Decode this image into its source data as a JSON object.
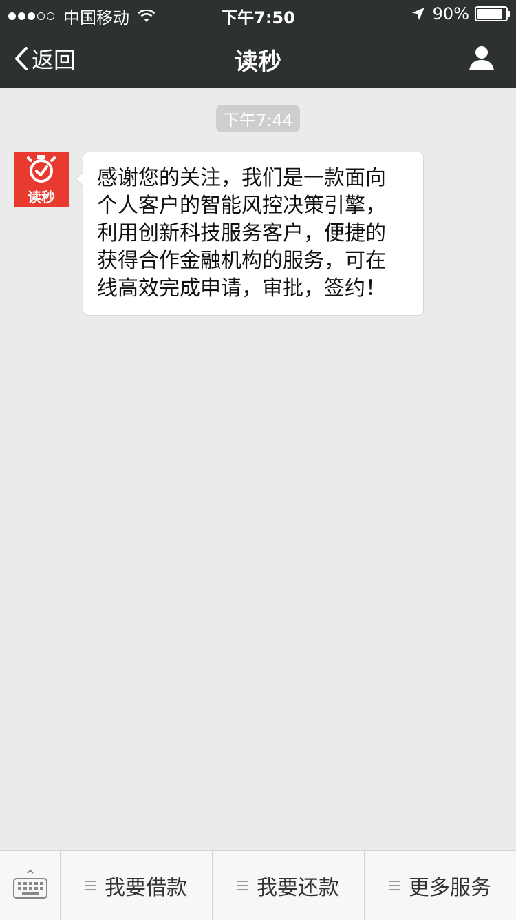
{
  "status_bar": {
    "carrier": "中国移动",
    "time": "下午7:50",
    "battery_text": "90%",
    "battery_level": 0.9
  },
  "nav": {
    "back_label": "返回",
    "title": "读秒"
  },
  "chat": {
    "timestamp": "下午7:44",
    "avatar_text": "读秒",
    "message_lines": [
      "感谢您的关注，我们是一款面向",
      "个人客户的智能风控决策引擎，",
      "利用创新科技服务客户，便捷的",
      "获得合作金融机构的服务，可在",
      "线高效完成申请，审批，签约！"
    ]
  },
  "menu": {
    "items": [
      {
        "label": "我要借款"
      },
      {
        "label": "我要还款"
      },
      {
        "label": "更多服务"
      }
    ]
  },
  "colors": {
    "nav_bg": "#2e3132",
    "chat_bg": "#ebebeb",
    "brand_red": "#e83a2e"
  }
}
